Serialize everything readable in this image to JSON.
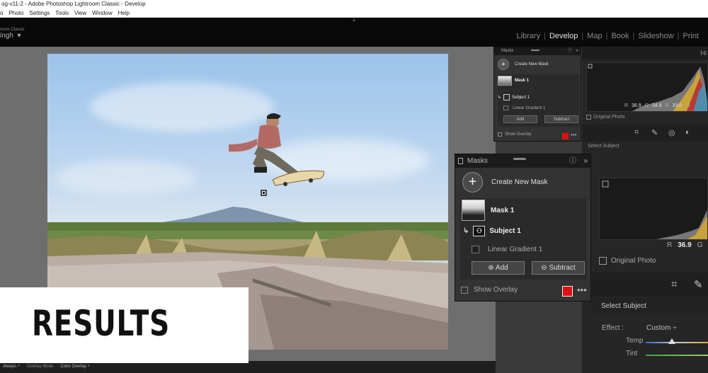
{
  "window": {
    "title": "og-v11-2 - Adobe Photoshop Lightroom Classic - Develop"
  },
  "menu": [
    "o",
    "Photo",
    "Settings",
    "Tools",
    "View",
    "Window",
    "Help"
  ],
  "identity": {
    "app_small": "room Classic",
    "user": "ingh",
    "caret": "▾"
  },
  "modules": [
    {
      "label": "Library",
      "active": false
    },
    {
      "label": "Develop",
      "active": true
    },
    {
      "label": "Map",
      "active": false
    },
    {
      "label": "Book",
      "active": false
    },
    {
      "label": "Slideshow",
      "active": false
    },
    {
      "label": "Print",
      "active": false
    }
  ],
  "right_panel": {
    "header": "Hi",
    "rgb": {
      "r_label": "R",
      "r": "36.9",
      "g_label": "G",
      "g": "34.8",
      "b_label": "B",
      "b": "33.6",
      "pct": "%"
    },
    "original_photo": "Original Photo",
    "select_subject": "Select Subject"
  },
  "big_right_panel": {
    "rgb": {
      "r_label": "R",
      "r": "36.9",
      "g_label": "G"
    },
    "original_photo": "Original Photo",
    "select_subject": "Select Subject",
    "effect_label": "Effect :",
    "effect_value": "Custom ÷",
    "temp_label": "Temp",
    "tint_label": "Tint"
  },
  "masks_small": {
    "title": "Masks",
    "create": "Create New Mask",
    "mask1": "Mask 1",
    "subject": "Subject 1",
    "gradient": "Linear Gradient 1",
    "add": "Add",
    "subtract": "Subtract",
    "show_overlay": "Show Overlay"
  },
  "masks_large": {
    "title": "Masks",
    "create": "Create New Mask",
    "mask1": "Mask 1",
    "subject": "Subject 1",
    "gradient": "Linear Gradient 1",
    "add": "Add",
    "subtract": "Subtract",
    "show_overlay": "Show Overlay"
  },
  "bottom_bar": {
    "always": "Always ÷",
    "overlay_mode": "Overlay Mode",
    "overlay_value": "Color Overlay ÷"
  },
  "banner": {
    "text": "RESULTS"
  },
  "colors": {
    "overlay_swatch": "#dd1111",
    "accent_text": "#e6e6e6"
  }
}
